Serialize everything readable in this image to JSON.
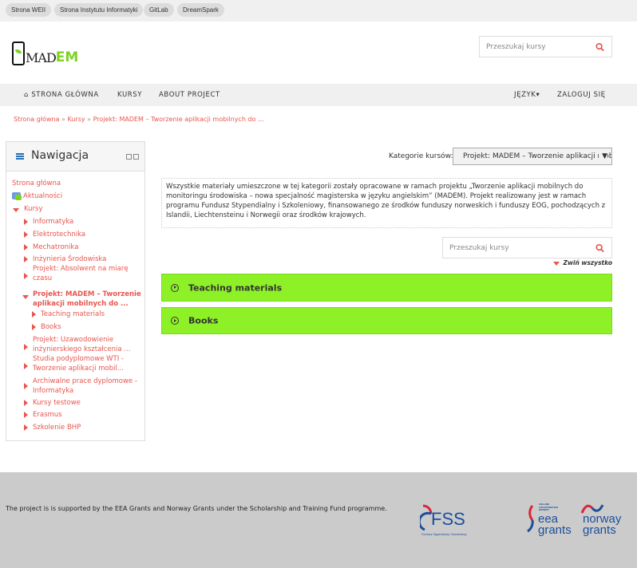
{
  "topbar": {
    "links": [
      "Strona WEII",
      "Strona Instytutu Informatyki",
      "GitLab",
      "DreamSpark"
    ]
  },
  "logo": {
    "part1": "MAD",
    "part2": "EM"
  },
  "header_search": {
    "placeholder": "Przeszukaj kursy"
  },
  "nav": {
    "home": "STRONA GŁÓWNA",
    "courses": "KURSY",
    "about": "ABOUT PROJECT",
    "language": "JĘZYK",
    "login": "ZALOGUJ SIĘ"
  },
  "breadcrumb": {
    "items": [
      "Strona główna",
      "Kursy",
      "Projekt: MADEM – Tworzenie aplikacji mobilnych do ..."
    ],
    "separator": "»"
  },
  "sidebar": {
    "title": "Nawigacja",
    "items": [
      "Strona główna",
      "Aktualności",
      "Kursy",
      "Informatyka",
      "Elektrotechnika",
      "Mechatronika",
      "Inżynieria Środowiska",
      "Projekt: Absolwent na miarę czasu",
      "Projekt: MADEM – Tworzenie aplikacji mobilnych do ...",
      "Teaching materials",
      "Books",
      "Projekt: Uzawodowienie inżynierskiego kształcenia ...",
      "Studia podyplomowe WTI - Tworzenie aplikacji mobil...",
      "Archiwalne prace dyplomowe - Informatyka",
      "Kursy testowe",
      "Erasmus",
      "Szkolenie BHP"
    ]
  },
  "main": {
    "category_label": "Kategorie kursów:",
    "category_value": "Projekt: MADEM – Tworzenie aplikacji mobilnych do monitoringu środowiska",
    "description": "Wszystkie materiały umieszczone w tej kategorii zostały opracowane w ramach projektu „Tworzenie aplikacji mobilnych do monitoringu środowiska – nowa specjalność magisterska w języku angielskim” (MADEM). Projekt realizowany jest w ramach programu Fundusz Stypendialny i Szkoleniowy, finansowanego ze środków funduszy norweskich i funduszy EOG, pochodzących z Islandii, Liechtensteinu i Norwegii oraz środków krajowych.",
    "search_placeholder": "Przeszukaj kursy",
    "collapse_all": "Zwiń wszystko",
    "sections": [
      "Teaching materials",
      "Books"
    ],
    "section_color": "#8ef026"
  },
  "footer": {
    "text": "The project is is supported by the EEA Grants and Norway Grants under the Scholarship and Training Fund programme.",
    "logos": {
      "fss": "FSS",
      "fss_sub": "Fundusz Stypendialny i Szkoleniowy",
      "eea_small": "ICELAND LIECHTENSTEIN NORWAY",
      "eea": "eea grants",
      "norway": "norway grants"
    }
  },
  "colors": {
    "link": "#e8554e",
    "accent": "#7ed321",
    "footer_bg": "#cbcbcb"
  }
}
